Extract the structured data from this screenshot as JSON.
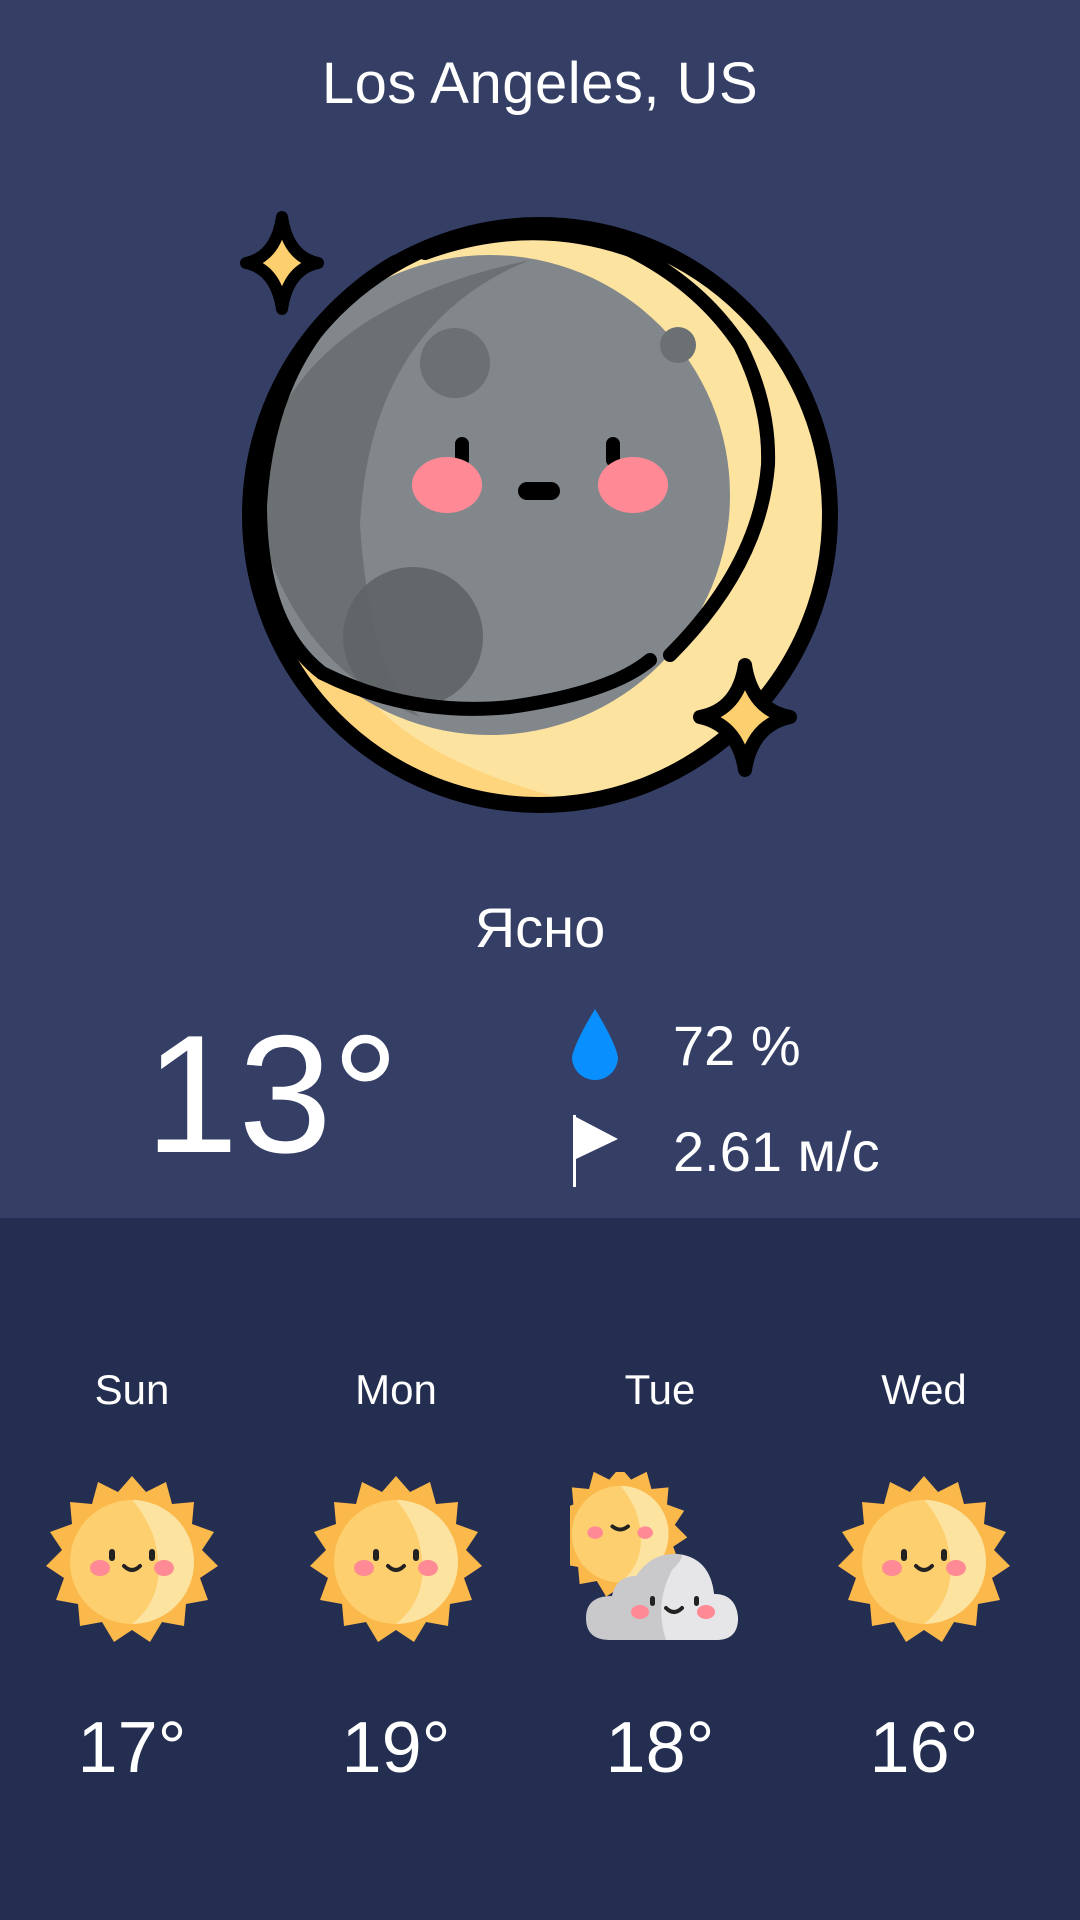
{
  "current": {
    "city": "Los Angeles, US",
    "icon": "moon-icon",
    "condition": "Ясно",
    "temperature": "13°",
    "humidity": "72 %",
    "humidity_icon": "droplet-icon",
    "wind": "2.61 м/с",
    "wind_icon": "flag-icon"
  },
  "forecast": [
    {
      "day": "Sun",
      "icon": "sun-icon",
      "temp": "17°"
    },
    {
      "day": "Mon",
      "icon": "sun-icon",
      "temp": "19°"
    },
    {
      "day": "Tue",
      "icon": "sun-cloud-icon",
      "temp": "18°"
    },
    {
      "day": "Wed",
      "icon": "sun-icon",
      "temp": "16°"
    }
  ],
  "colors": {
    "top_background": "#353f66",
    "bottom_background": "#242e50",
    "droplet": "#0a8fff",
    "moon_face": "#82878c",
    "crescent": "#fde3a0",
    "sun": "#fbb84b",
    "cheek": "#ff8a95"
  }
}
